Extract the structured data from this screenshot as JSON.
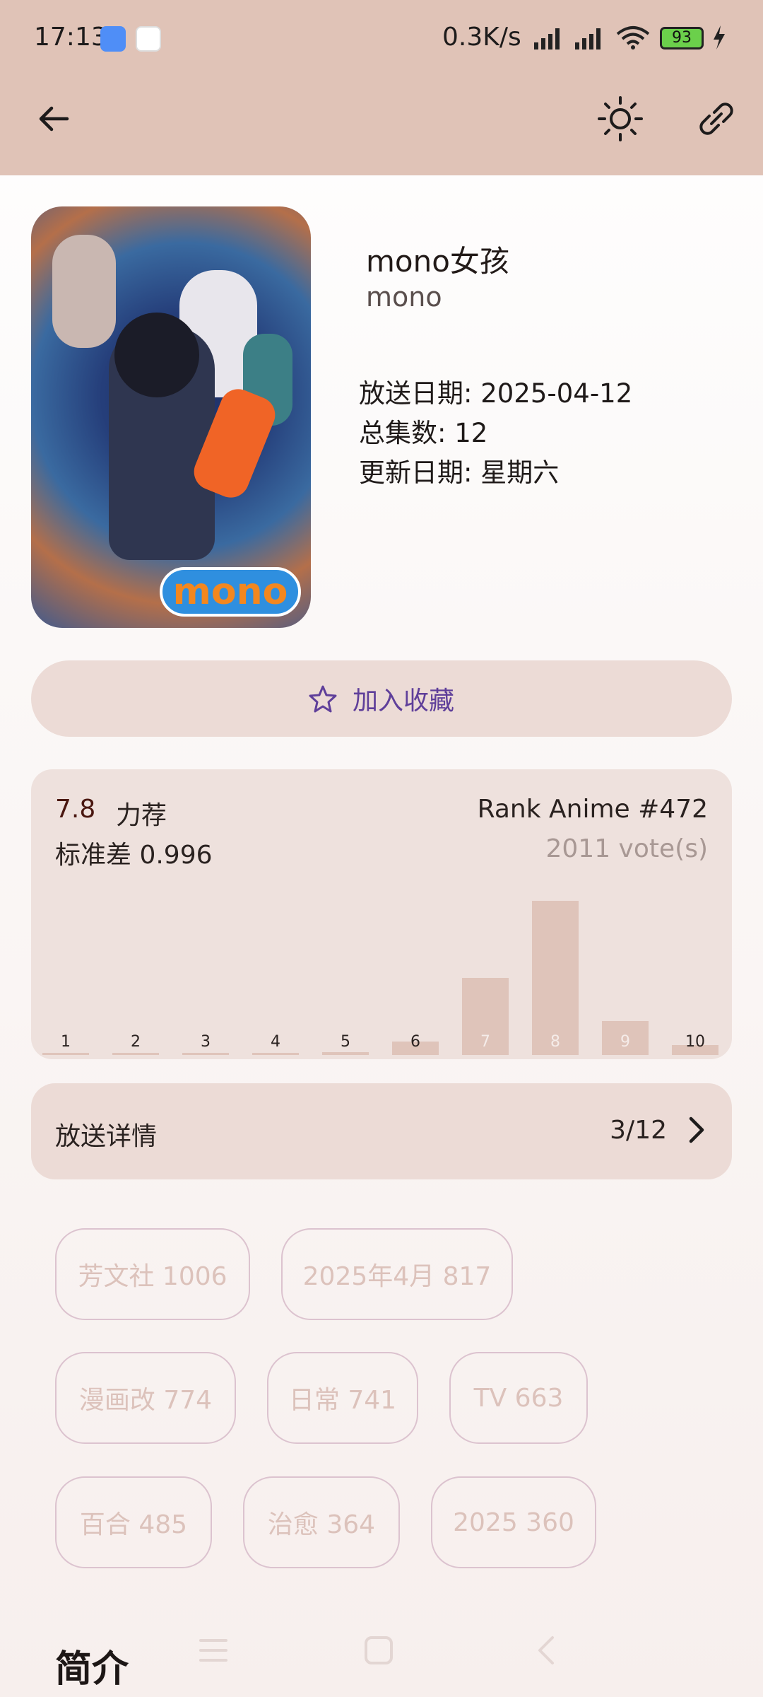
{
  "status_bar": {
    "time": "17:13",
    "net_speed": "0.3K/s",
    "battery": "93"
  },
  "app_bar": {
    "back_icon": "arrow-left-icon",
    "theme_icon": "sun-icon",
    "link_icon": "link-icon"
  },
  "subject": {
    "title": "mono女孩",
    "subtitle": "mono",
    "poster_logo": "mono",
    "air_date": "放送日期: 2025-04-12",
    "episodes": "总集数: 12",
    "update_day": "更新日期: 星期六"
  },
  "actions": {
    "favorite_label": "加入收藏"
  },
  "rating": {
    "score": "7.8",
    "score_text": "力荐",
    "stddev": "标准差 0.996",
    "rank": "Rank Anime #472",
    "votes": "2011 vote(s)"
  },
  "chart_data": {
    "type": "bar",
    "categories": [
      "1",
      "2",
      "3",
      "4",
      "5",
      "6",
      "7",
      "8",
      "9",
      "10"
    ],
    "values": [
      1,
      1,
      1,
      1,
      8,
      35,
      200,
      401,
      88,
      25
    ],
    "xlabel": "",
    "ylabel": ""
  },
  "broadcast": {
    "label": "放送详情",
    "progress": "3/12"
  },
  "tags": [
    {
      "label": "芳文社 1006"
    },
    {
      "label": "2025年4月 817"
    },
    {
      "label": "漫画改 774"
    },
    {
      "label": "日常 741"
    },
    {
      "label": "TV 663"
    },
    {
      "label": "百合 485"
    },
    {
      "label": "治愈 364"
    },
    {
      "label": "2025 360"
    }
  ],
  "section": {
    "intro_title": "简介"
  },
  "colors": {
    "app_bar": "#e0c3b7",
    "accent": "#5f3f9a",
    "bar": "#dfc4ba"
  }
}
